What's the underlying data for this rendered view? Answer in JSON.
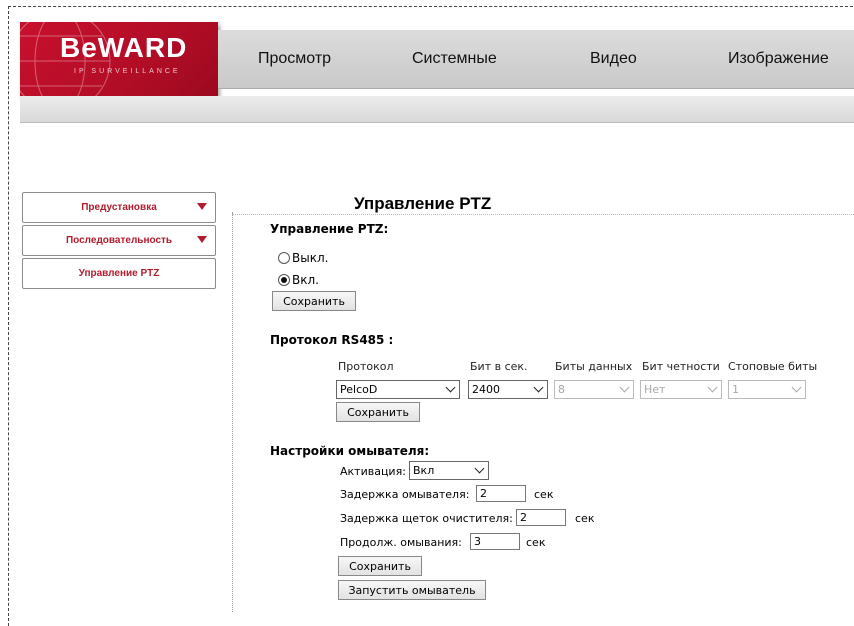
{
  "brand": {
    "logo_text": "BeWARD",
    "logo_subtext": "IP SURVEILLANCE",
    "accent": "#c8102e"
  },
  "nav": {
    "items": [
      "Просмотр",
      "Системные",
      "Видео",
      "Изображение"
    ]
  },
  "sidebar": {
    "items": [
      {
        "label": "Предустановка",
        "has_arrow": true
      },
      {
        "label": "Последовательность",
        "has_arrow": true
      },
      {
        "label": "Управление PTZ",
        "has_arrow": false
      }
    ]
  },
  "page": {
    "title": "Управление PTZ"
  },
  "ptz_control": {
    "label": "Управление PTZ:",
    "options": [
      "Выкл.",
      "Вкл."
    ],
    "selected": "Вкл.",
    "save_label": "Сохранить"
  },
  "rs485": {
    "label": "Протокол RS485 :",
    "columns": [
      "Протокол",
      "Бит в сек.",
      "Биты данных",
      "Бит четности",
      "Стоповые биты"
    ],
    "values": [
      "PelcoD",
      "2400",
      "8",
      "Нет",
      "1"
    ],
    "save_label": "Сохранить"
  },
  "wiper": {
    "label": "Настройки омывателя:",
    "activation_label": "Активация:",
    "activation_value": "Вкл",
    "delay_label": "Задержка омывателя:",
    "delay_value": "2",
    "delay_unit": "сек",
    "brush_delay_label": "Задержка щеток очистителя:",
    "brush_delay_value": "2",
    "brush_delay_unit": "сек",
    "duration_label": "Продолж. омывания:",
    "duration_value": "3",
    "duration_unit": "сек",
    "save_label": "Сохранить",
    "start_label": "Запустить омыватель"
  }
}
